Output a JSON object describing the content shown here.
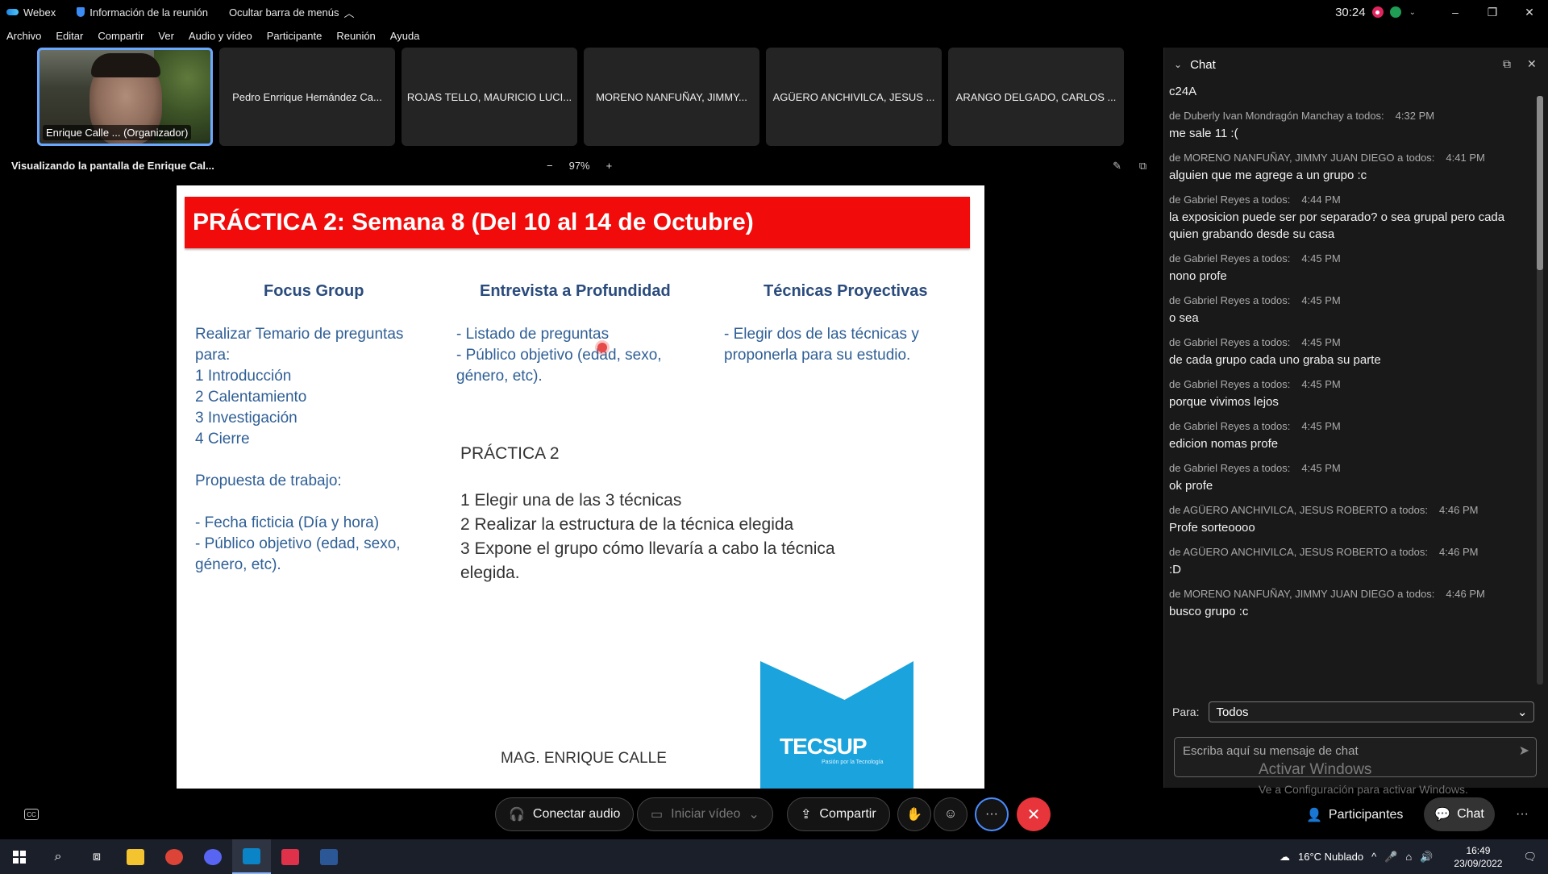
{
  "titlebar": {
    "app_name": "Webex",
    "meeting_info": "Información de la reunión",
    "hide_menu": "Ocultar barra de menús",
    "timer": "30:24"
  },
  "menu": [
    "Archivo",
    "Editar",
    "Compartir",
    "Ver",
    "Audio y vídeo",
    "Participante",
    "Reunión",
    "Ayuda"
  ],
  "participants": {
    "self_label": "Enrique Calle ... (Organizador)",
    "others": [
      "Pedro Enrrique Hernández Ca...",
      "ROJAS TELLO, MAURICIO LUCI...",
      "MORENO NANFUÑAY, JIMMY...",
      "AGÜERO ANCHIVILCA, JESUS ...",
      "ARANGO DELGADO, CARLOS ..."
    ]
  },
  "share": {
    "header": "Visualizando la pantalla de Enrique Cal...",
    "zoom_minus": "−",
    "zoom": "97%",
    "zoom_plus": "+"
  },
  "slide": {
    "title": "PRÁCTICA 2: Semana 8 (Del 10 al 14 de Octubre)",
    "col1_head": "Focus Group",
    "col2_head": "Entrevista a Profundidad",
    "col3_head": "Técnicas Proyectivas",
    "col1_lines": [
      "Realizar Temario de preguntas",
      "para:",
      "1 Introducción",
      "2 Calentamiento",
      "3 Investigación",
      "4 Cierre",
      "",
      "Propuesta de trabajo:",
      "",
      "- Fecha ficticia (Día y hora)",
      "- Público objetivo (edad, sexo,",
      "género, etc)."
    ],
    "col2_lines": [
      "- Listado de preguntas",
      "- Público objetivo (edad, sexo,",
      "género, etc)."
    ],
    "col3_lines": [
      "- Elegir dos de las técnicas y",
      "proponerla para su estudio."
    ],
    "mid_title": "PRÁCTICA 2",
    "mid_lines": [
      "1 Elegir una de las 3 técnicas",
      "2 Realizar la estructura de la técnica elegida",
      "3 Expone el grupo cómo llevaría a cabo la técnica",
      "elegida."
    ],
    "author": "MAG. ENRIQUE CALLE",
    "logo_text": "TECSUP",
    "logo_sub": "Pasión por la Tecnología"
  },
  "chat": {
    "title": "Chat",
    "first_line": "c24A",
    "messages": [
      {
        "from": "de Duberly Ivan Mondragón Manchay a todos:",
        "time": "4:32 PM",
        "text": "me sale 11 :("
      },
      {
        "from": "de MORENO NANFUÑAY, JIMMY JUAN DIEGO a todos:",
        "time": "4:41 PM",
        "text": "alguien que me agrege a un grupo :c"
      },
      {
        "from": "de Gabriel Reyes a todos:",
        "time": "4:44 PM",
        "text": "la exposicion puede ser por separado? o sea grupal pero cada quien grabando desde su casa"
      },
      {
        "from": "de Gabriel Reyes a todos:",
        "time": "4:45 PM",
        "text": "nono profe"
      },
      {
        "from": "de Gabriel Reyes a todos:",
        "time": "4:45 PM",
        "text": "o sea"
      },
      {
        "from": "de Gabriel Reyes a todos:",
        "time": "4:45 PM",
        "text": "de cada grupo cada uno graba su parte"
      },
      {
        "from": "de Gabriel Reyes a todos:",
        "time": "4:45 PM",
        "text": "porque vivimos lejos"
      },
      {
        "from": "de Gabriel Reyes a todos:",
        "time": "4:45 PM",
        "text": "edicion nomas profe"
      },
      {
        "from": "de Gabriel Reyes a todos:",
        "time": "4:45 PM",
        "text": "ok profe"
      },
      {
        "from": "de AGÜERO ANCHIVILCA, JESUS ROBERTO a todos:",
        "time": "4:46 PM",
        "text": "Profe sorteoooo"
      },
      {
        "from": "de AGÜERO ANCHIVILCA, JESUS ROBERTO a todos:",
        "time": "4:46 PM",
        "text": ":D"
      },
      {
        "from": "de MORENO NANFUÑAY, JIMMY JUAN DIEGO a todos:",
        "time": "4:46 PM",
        "text": "busco grupo :c"
      }
    ],
    "to_label": "Para:",
    "to_value": "Todos",
    "input_placeholder": "Escriba aquí su mensaje de chat"
  },
  "watermark": {
    "line1": "Activar Windows",
    "line2": "Ve a Configuración para activar Windows."
  },
  "controls": {
    "audio": "Conectar audio",
    "video": "Iniciar vídeo",
    "share": "Compartir",
    "participants": "Participantes",
    "chat": "Chat"
  },
  "taskbar": {
    "weather": "16°C  Nublado",
    "time": "16:49",
    "date": "23/09/2022"
  },
  "colors": {
    "slide_title_bg": "#f20b0b",
    "end_call": "#e8353b",
    "active_border": "#6aa8ff"
  }
}
